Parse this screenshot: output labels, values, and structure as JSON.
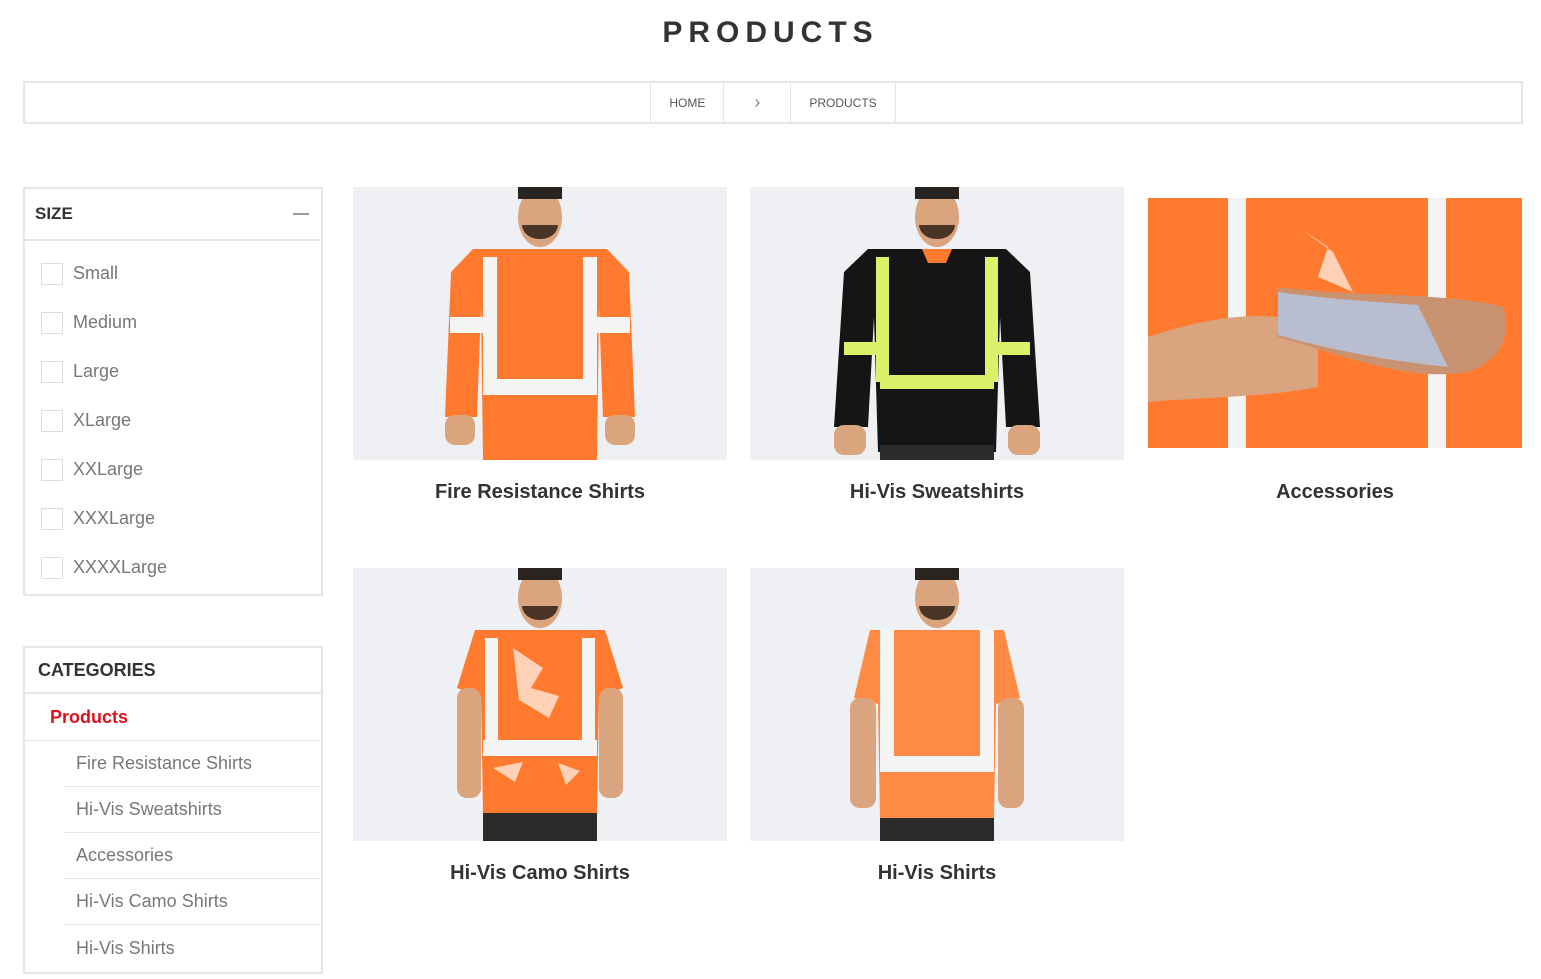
{
  "page": {
    "title": "PRODUCTS"
  },
  "breadcrumb": {
    "home": "HOME",
    "separator": "›",
    "current": "PRODUCTS"
  },
  "size_filter": {
    "heading": "SIZE",
    "options": [
      "Small",
      "Medium",
      "Large",
      "XLarge",
      "XXLarge",
      "XXXLarge",
      "XXXXLarge"
    ]
  },
  "categories": {
    "heading": "CATEGORIES",
    "active": "Products",
    "items": [
      "Fire Resistance Shirts",
      "Hi-Vis Sweatshirts",
      "Accessories",
      "Hi-Vis Camo Shirts",
      "Hi-Vis Shirts"
    ]
  },
  "products": [
    {
      "name": "Fire Resistance Shirts",
      "icon": "orange-long-sleeve-shirt"
    },
    {
      "name": "Hi-Vis Sweatshirts",
      "icon": "black-hi-vis-sweatshirt"
    },
    {
      "name": "Accessories",
      "icon": "arm-sleeve-accessory"
    },
    {
      "name": "Hi-Vis Camo Shirts",
      "icon": "orange-camo-shirt"
    },
    {
      "name": "Hi-Vis Shirts",
      "icon": "orange-short-sleeve-shirt"
    }
  ],
  "colors": {
    "accent_red": "#d9141e",
    "hi_vis_orange": "#ff7a2e",
    "reflective_stripe": "#f4f4f4",
    "sweatshirt_black": "#151515",
    "lime_stripe": "#d9f26a",
    "sleeve_grey": "#b9bdd0"
  }
}
